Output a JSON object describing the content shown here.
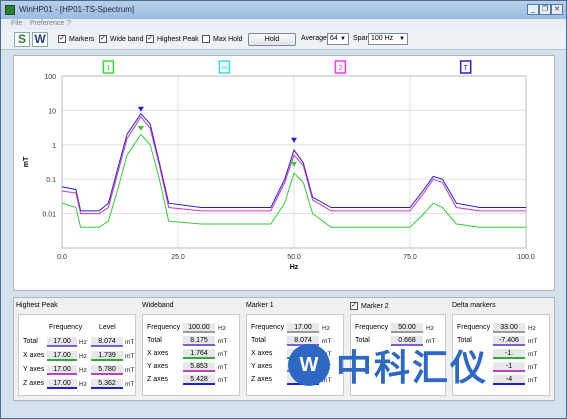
{
  "window": {
    "title": "WinHP01 - [HP01-TS-Spectrum]"
  },
  "menu": [
    "File",
    "Preference",
    "?"
  ],
  "toolbar": {
    "s_label": "S",
    "w_label": "W",
    "checks": [
      {
        "label": "Markers",
        "checked": true
      },
      {
        "label": "Wide band",
        "checked": true
      },
      {
        "label": "Highest Peak",
        "checked": true
      },
      {
        "label": "Max Hold",
        "checked": false
      }
    ],
    "hold_label": "Hold",
    "average_label": "Average",
    "average_value": "64",
    "span_label": "Span",
    "span_value": "100 Hz"
  },
  "chart_data": {
    "type": "line",
    "xlabel": "Hz",
    "ylabel": "mT",
    "xlim": [
      0,
      100
    ],
    "ylim_log": [
      0.001,
      100
    ],
    "yscale": "log",
    "x_ticks": [
      "0.0",
      "25.0",
      "50.0",
      "75.0",
      "100.0"
    ],
    "y_ticks": [
      "100",
      "10",
      "1",
      "0.1",
      "0.01"
    ],
    "grid": true,
    "markers": [
      {
        "label": "1",
        "x": 10,
        "color": "#33dd33"
      },
      {
        "label": "2",
        "x": 60,
        "color": "#ff33ff"
      },
      {
        "label": "H",
        "x": 35,
        "color": "#33dddd"
      },
      {
        "label": "T",
        "x": 87,
        "color": "#2222cc"
      }
    ],
    "series": [
      {
        "color": "#2222cc",
        "points": [
          [
            0,
            0.06
          ],
          [
            3,
            0.05
          ],
          [
            4,
            0.012
          ],
          [
            8,
            0.012
          ],
          [
            10,
            0.02
          ],
          [
            12,
            0.2
          ],
          [
            14,
            2
          ],
          [
            17,
            8
          ],
          [
            19,
            4
          ],
          [
            21,
            0.3
          ],
          [
            23,
            0.02
          ],
          [
            30,
            0.015
          ],
          [
            45,
            0.015
          ],
          [
            48,
            0.1
          ],
          [
            50,
            0.7
          ],
          [
            52,
            0.3
          ],
          [
            54,
            0.03
          ],
          [
            58,
            0.015
          ],
          [
            75,
            0.015
          ],
          [
            78,
            0.05
          ],
          [
            80,
            0.12
          ],
          [
            82,
            0.1
          ],
          [
            85,
            0.02
          ],
          [
            90,
            0.015
          ],
          [
            100,
            0.015
          ]
        ]
      },
      {
        "color": "#cc33cc",
        "points": [
          [
            0,
            0.045
          ],
          [
            3,
            0.04
          ],
          [
            4,
            0.01
          ],
          [
            8,
            0.01
          ],
          [
            10,
            0.015
          ],
          [
            12,
            0.15
          ],
          [
            14,
            1.5
          ],
          [
            17,
            6.5
          ],
          [
            19,
            3
          ],
          [
            21,
            0.25
          ],
          [
            23,
            0.015
          ],
          [
            30,
            0.012
          ],
          [
            45,
            0.012
          ],
          [
            48,
            0.08
          ],
          [
            50,
            0.5
          ],
          [
            52,
            0.25
          ],
          [
            54,
            0.025
          ],
          [
            58,
            0.012
          ],
          [
            75,
            0.012
          ],
          [
            78,
            0.04
          ],
          [
            80,
            0.1
          ],
          [
            82,
            0.08
          ],
          [
            85,
            0.015
          ],
          [
            90,
            0.012
          ],
          [
            100,
            0.012
          ]
        ]
      },
      {
        "color": "#33cc33",
        "points": [
          [
            0,
            0.02
          ],
          [
            3,
            0.015
          ],
          [
            4,
            0.004
          ],
          [
            8,
            0.004
          ],
          [
            10,
            0.006
          ],
          [
            12,
            0.05
          ],
          [
            14,
            0.5
          ],
          [
            17,
            2
          ],
          [
            19,
            1
          ],
          [
            21,
            0.1
          ],
          [
            23,
            0.006
          ],
          [
            30,
            0.005
          ],
          [
            45,
            0.005
          ],
          [
            48,
            0.02
          ],
          [
            50,
            0.15
          ],
          [
            52,
            0.08
          ],
          [
            54,
            0.01
          ],
          [
            58,
            0.004
          ],
          [
            75,
            0.004
          ],
          [
            78,
            0.01
          ],
          [
            80,
            0.02
          ],
          [
            82,
            0.015
          ],
          [
            85,
            0.005
          ],
          [
            90,
            0.004
          ],
          [
            100,
            0.004
          ]
        ]
      }
    ],
    "peak_markers": [
      {
        "x": 17,
        "y": 8,
        "color": "#2222cc"
      },
      {
        "x": 17,
        "y": 2.2,
        "color": "#33cc33"
      },
      {
        "x": 50,
        "y": 1.0,
        "color": "#2222cc"
      },
      {
        "x": 50,
        "y": 0.2,
        "color": "#33cc33"
      }
    ]
  },
  "panels": {
    "highest_peak": {
      "title": "Highest Peak",
      "col_freq": "Frequency",
      "col_level": "Level",
      "rows": [
        {
          "label": "Total",
          "freq": "17.00",
          "fu": "Hz",
          "level": "8.074",
          "lu": "mT"
        },
        {
          "label": "X axes",
          "freq": "17.00",
          "fu": "Hz",
          "level": "1.739",
          "lu": "mT"
        },
        {
          "label": "Y axes",
          "freq": "17.00",
          "fu": "Hz",
          "level": "5.780",
          "lu": "mT"
        },
        {
          "label": "Z axes",
          "freq": "17.00",
          "fu": "Hz",
          "level": "5.362",
          "lu": "mT"
        }
      ]
    },
    "wideband": {
      "title": "Wideband",
      "rows": [
        {
          "label": "Frequency",
          "value": "100.00",
          "unit": "Hz"
        },
        {
          "label": "Total",
          "value": "8.175",
          "unit": "mT"
        },
        {
          "label": "X axes",
          "value": "1.764",
          "unit": "mT"
        },
        {
          "label": "Y axes",
          "value": "5.853",
          "unit": "mT"
        },
        {
          "label": "Z axes",
          "value": "5.428",
          "unit": "mT"
        }
      ]
    },
    "marker1": {
      "title": "Marker 1",
      "rows": [
        {
          "label": "Frequency",
          "value": "17.00",
          "unit": "Hz"
        },
        {
          "label": "Total",
          "value": "8.074",
          "unit": "mT"
        },
        {
          "label": "X axes",
          "value": "",
          "unit": "mT"
        },
        {
          "label": "Y axes",
          "value": "",
          "unit": "mT"
        },
        {
          "label": "Z axes",
          "value": "",
          "unit": "mT"
        }
      ]
    },
    "marker2": {
      "title": "Marker 2",
      "checked": true,
      "rows": [
        {
          "label": "Frequency",
          "value": "50.00",
          "unit": "Hz"
        },
        {
          "label": "Total",
          "value": "0.668",
          "unit": "mT"
        }
      ]
    },
    "delta": {
      "title": "Delta markers",
      "rows": [
        {
          "label": "Frequency",
          "value": "33.00",
          "unit": "Hz"
        },
        {
          "label": "Total",
          "value": "-7.406",
          "unit": "mT"
        },
        {
          "label": "",
          "value": "-1.",
          "unit": "mT"
        },
        {
          "label": "",
          "value": "-1",
          "unit": "mT"
        },
        {
          "label": "",
          "value": "-4",
          "unit": "mT"
        }
      ]
    }
  },
  "watermark": {
    "text": "中科汇仪",
    "logo": "W"
  }
}
